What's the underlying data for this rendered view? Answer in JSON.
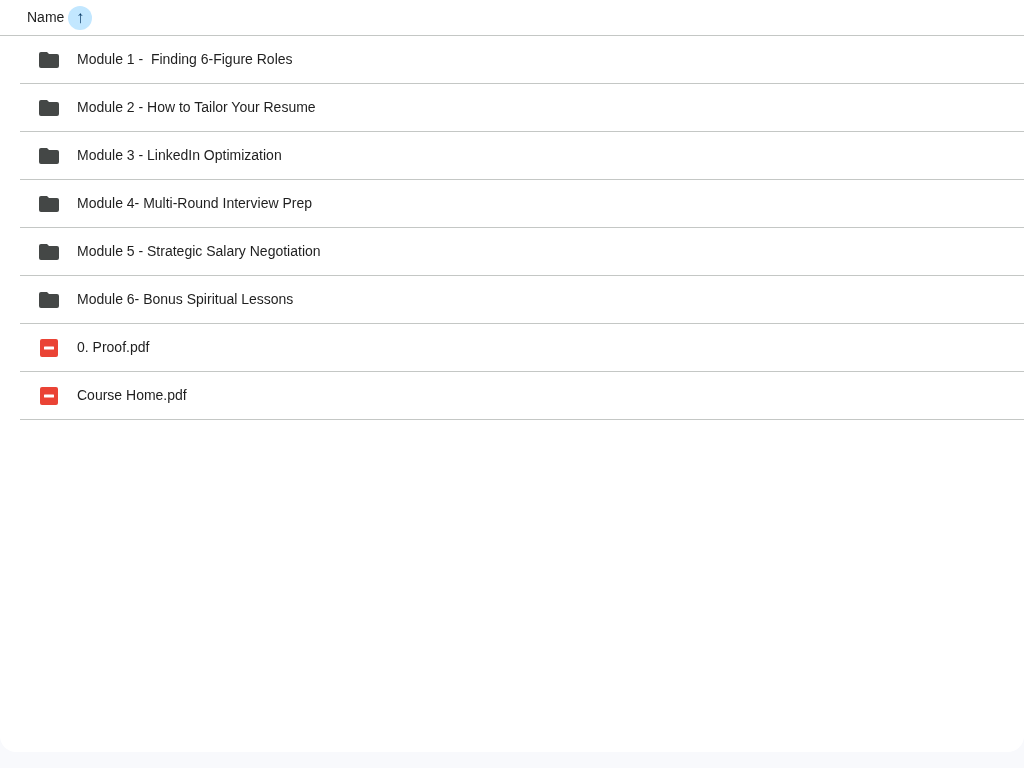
{
  "header": {
    "column": "Name",
    "sort_icon": "↑"
  },
  "files": [
    {
      "kind": "folder",
      "name": "Module 1 -  Finding 6-Figure Roles"
    },
    {
      "kind": "folder",
      "name": "Module 2 - How to Tailor Your Resume"
    },
    {
      "kind": "folder",
      "name": "Module 3 - LinkedIn Optimization"
    },
    {
      "kind": "folder",
      "name": "Module 4- Multi-Round Interview Prep"
    },
    {
      "kind": "folder",
      "name": "Module 5 - Strategic Salary Negotiation"
    },
    {
      "kind": "folder",
      "name": "Module 6- Bonus Spiritual Lessons"
    },
    {
      "kind": "pdf",
      "name": "0. Proof.pdf"
    },
    {
      "kind": "pdf",
      "name": "Course Home.pdf"
    }
  ]
}
